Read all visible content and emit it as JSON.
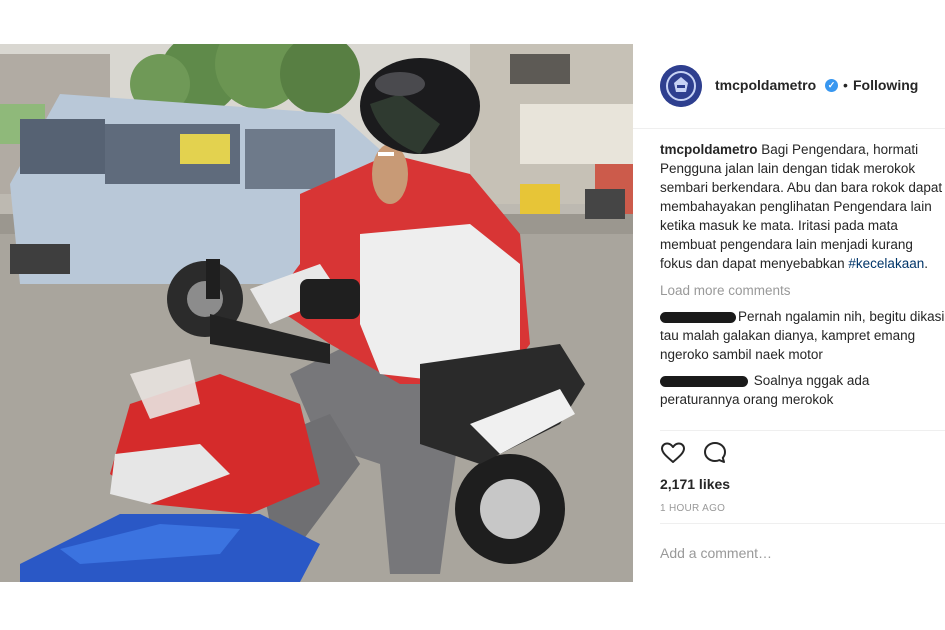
{
  "post": {
    "username": "tmcpoldametro",
    "follow_status": "Following",
    "dot": "•",
    "caption": {
      "username": "tmcpoldametro",
      "text": "Bagi Pengendara, hormati Pengguna jalan lain dengan tidak merokok sembari berkendara. Abu dan bara rokok dapat membahayakan penglihatan Pengendara lain ketika masuk ke mata. Iritasi pada mata membuat pengendara lain menjadi kurang fokus dan dapat menyebabkan",
      "hashtag": "#kecelakaan",
      "end": "."
    },
    "load_more": "Load more comments",
    "comments": [
      {
        "text": "Pernah ngalamin nih, begitu dikasi tau malah galakan dianya, kampret emang ngeroko sambil naek motor"
      },
      {
        "text": "Soalnya nggak ada peraturannya orang merokok"
      }
    ],
    "likes": "2,171 likes",
    "time_ago": "1 HOUR AGO",
    "add_comment_placeholder": "Add a comment…"
  },
  "icons": {
    "verified": "verified-badge-icon",
    "like": "heart-icon",
    "comment": "comment-icon"
  },
  "colors": {
    "verified": "#3897f0",
    "hashtag": "#003569",
    "muted": "#999999",
    "text": "#262626",
    "avatar": "#2e3f8f"
  }
}
